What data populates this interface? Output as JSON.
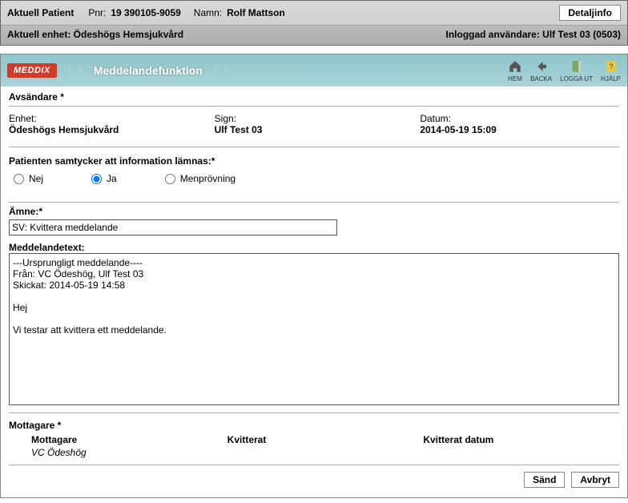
{
  "patient_bar": {
    "aktuell_label": "Aktuell Patient",
    "pnr_label": "Pnr:",
    "pnr_value": "19 390105-9059",
    "name_label": "Namn:",
    "name_value": "Rolf Mattson",
    "detail_btn": "Detaljinfo",
    "unit_line": "Aktuell enhet: Ödeshögs Hemsjukvård",
    "logged_in": "Inloggad användare: Ulf Test 03 (0503)"
  },
  "titlebar": {
    "logo": "MEDDIX",
    "title": "Meddelandefunktion",
    "icons": {
      "hem": "HEM",
      "backa": "BACKA",
      "loggaut": "LOGGA UT",
      "hjalp": "HJÄLP"
    }
  },
  "sender": {
    "heading": "Avsändare *",
    "enhet_label": "Enhet:",
    "enhet_value": "Ödeshögs Hemsjukvård",
    "sign_label": "Sign:",
    "sign_value": "Ulf Test 03",
    "datum_label": "Datum:",
    "datum_value": "2014-05-19 15:09"
  },
  "consent": {
    "label": "Patienten samtycker att information lämnas:*",
    "options": {
      "nej": "Nej",
      "ja": "Ja",
      "men": "Menprövning"
    },
    "selected": "ja"
  },
  "subject": {
    "label": "Ämne:*",
    "value": "SV: Kvittera meddelande"
  },
  "message": {
    "label": "Meddelandetext:",
    "text": "---Ursprungligt meddelande----\nFrån: VC Ödeshög, Ulf Test 03\nSkickat: 2014-05-19 14:58\n\nHej\n\nVi testar att kvittera ett meddelande."
  },
  "recipients": {
    "heading": "Mottagare *",
    "cols": {
      "mottagare": "Mottagare",
      "kvitterat": "Kvitterat",
      "kvitterat_datum": "Kvitterat datum"
    },
    "rows": [
      {
        "mottagare": "VC Ödeshög",
        "kvitterat": "",
        "kvitterat_datum": ""
      }
    ]
  },
  "footer": {
    "send": "Sänd",
    "cancel": "Avbryt"
  }
}
